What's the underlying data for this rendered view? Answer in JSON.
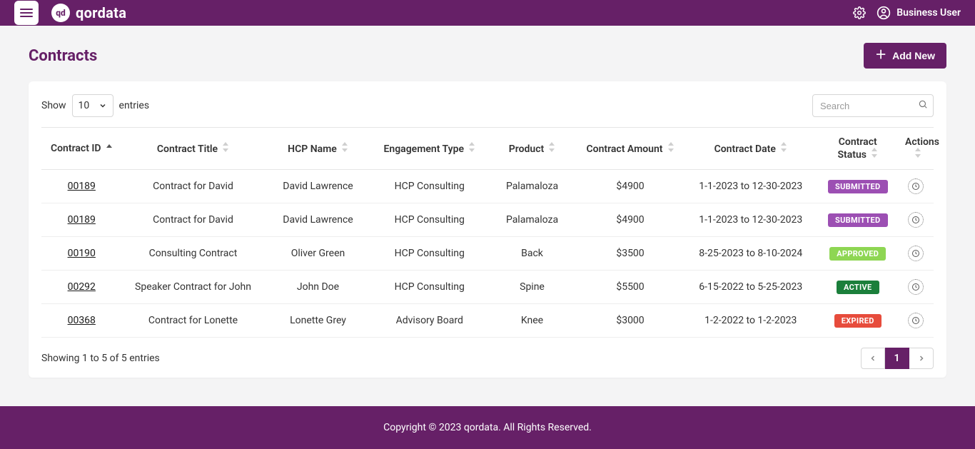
{
  "brand": {
    "logo_text": "qd",
    "name": "qordata"
  },
  "nav": {
    "user_label": "Business User"
  },
  "page": {
    "title": "Contracts",
    "add_button": "Add New"
  },
  "table": {
    "show_label": "Show",
    "entries_label": "entries",
    "page_size": "10",
    "search_placeholder": "Search",
    "columns": [
      "Contract ID",
      "Contract Title",
      "HCP Name",
      "Engagement Type",
      "Product",
      "Contract Amount",
      "Contract Date",
      "Contract Status",
      "Actions"
    ],
    "rows": [
      {
        "id": "00189",
        "title": "Contract for David",
        "hcp": "David Lawrence",
        "engagement": "HCP Consulting",
        "product": "Palamaloza",
        "amount": "$4900",
        "date": "1-1-2023 to 12-30-2023",
        "status": "SUBMITTED"
      },
      {
        "id": "00189",
        "title": "Contract for David",
        "hcp": "David Lawrence",
        "engagement": "HCP Consulting",
        "product": "Palamaloza",
        "amount": "$4900",
        "date": "1-1-2023 to 12-30-2023",
        "status": "SUBMITTED"
      },
      {
        "id": "00190",
        "title": "Consulting Contract",
        "hcp": "Oliver Green",
        "engagement": "HCP Consulting",
        "product": "Back",
        "amount": "$3500",
        "date": "8-25-2023 to 8-10-2024",
        "status": "APPROVED"
      },
      {
        "id": "00292",
        "title": "Speaker Contract for John",
        "hcp": "John Doe",
        "engagement": "HCP Consulting",
        "product": "Spine",
        "amount": "$5500",
        "date": "6-15-2022 to 5-25-2023",
        "status": "ACTIVE"
      },
      {
        "id": "00368",
        "title": "Contract for Lonette",
        "hcp": "Lonette Grey",
        "engagement": "Advisory Board",
        "product": "Knee",
        "amount": "$3000",
        "date": "1-2-2022 to 1-2-2023",
        "status": "EXPIRED"
      }
    ],
    "status_colors": {
      "SUBMITTED": "#9c4fb3",
      "APPROVED": "#8ed653",
      "ACTIVE": "#1b7f3b",
      "EXPIRED": "#e74c3c"
    },
    "footer_text": "Showing 1 to 5 of 5 entries",
    "current_page": "1"
  },
  "footer": {
    "text": "Copyright © 2023 qordata. All Rights Reserved."
  }
}
